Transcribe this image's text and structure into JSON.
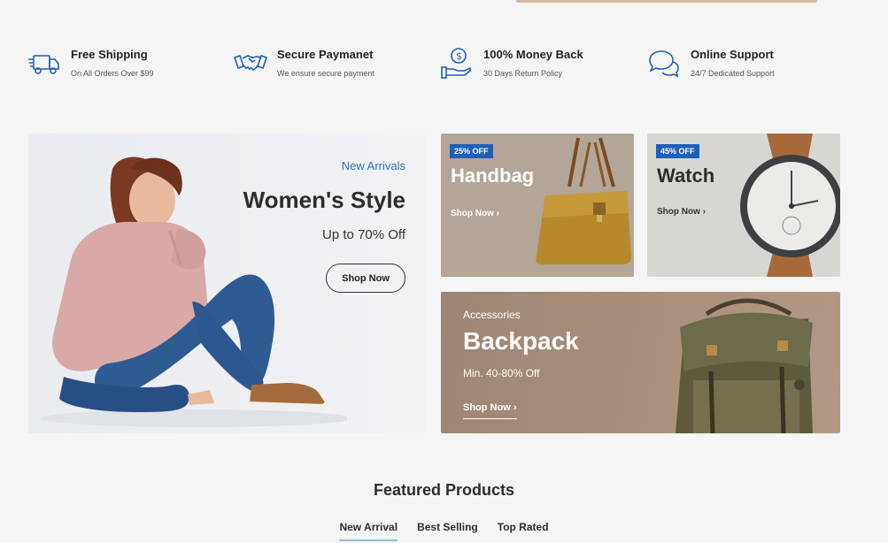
{
  "features": [
    {
      "icon": "truck-icon",
      "title": "Free Shipping",
      "subtitle": "On All Orders Over $99"
    },
    {
      "icon": "handshake-icon",
      "title": "Secure Paymanet",
      "subtitle": "We ensure secure payment"
    },
    {
      "icon": "money-hand-icon",
      "title": "100% Money Back",
      "subtitle": "30 Days Return Policy"
    },
    {
      "icon": "chat-bubbles-icon",
      "title": "Online Support",
      "subtitle": "24/7 Dedicated Support"
    }
  ],
  "banners": {
    "women": {
      "label": "New Arrivals",
      "title": "Women's Style",
      "subtitle": "Up to 70% Off",
      "button": "Shop Now"
    },
    "handbag": {
      "badge": "25% OFF",
      "title": "Handbag",
      "link": "Shop Now"
    },
    "watch": {
      "badge": "45% OFF",
      "title": "Watch",
      "link": "Shop Now"
    },
    "backpack": {
      "category": "Accessories",
      "title": "Backpack",
      "subtitle": "Min. 40-80% Off",
      "link": "Shop Now"
    }
  },
  "featured": {
    "title": "Featured Products",
    "tabs": [
      "New Arrival",
      "Best Selling",
      "Top Rated"
    ],
    "active_tab": "New Arrival"
  },
  "colors": {
    "accent": "#1f5fb8",
    "tab_underline": "#7ec6d6",
    "link_blue": "#2a6fc4"
  }
}
